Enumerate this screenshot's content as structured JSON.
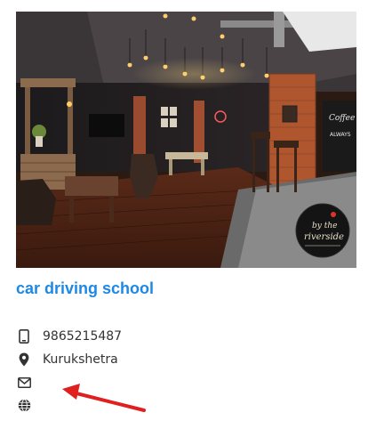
{
  "listing": {
    "title": "car driving school",
    "phone": "9865215487",
    "location": "Kurukshetra",
    "email": "",
    "website": ""
  },
  "photo": {
    "sign_line_1": "by the",
    "sign_line_2": "riverside",
    "chalkboard_line_1": "Coffee",
    "chalkboard_line_2": "ALWAYS"
  },
  "icons": {
    "phone": "mobile-phone-icon",
    "location": "map-pin-icon",
    "email": "envelope-icon",
    "website": "globe-icon"
  },
  "colors": {
    "title": "#1e88e5",
    "text": "#333333",
    "icon": "#333333",
    "annotation_arrow": "#e02020"
  }
}
